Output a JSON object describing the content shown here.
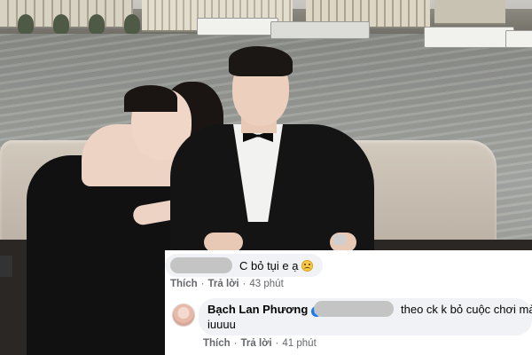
{
  "comments": [
    {
      "author_redacted": true,
      "text": "C bỏ tụi e ạ",
      "emoji": "disappointed-face-emoji",
      "actions": {
        "like": "Thích",
        "reply": "Trả lời",
        "separator": "·",
        "time": "43 phút"
      }
    },
    {
      "author": "Bạch Lan Phương",
      "verified": true,
      "tagged_redacted": true,
      "text_line1": "theo ck k bỏ cuộc chơi mà e",
      "text_line2": "iuuuu",
      "actions": {
        "like": "Thích",
        "reply": "Trả lời",
        "separator": "·",
        "time": "41 phút"
      }
    }
  ],
  "colors": {
    "bubble": "#f0f2f5",
    "text": "#050505",
    "meta": "#65676b",
    "verified": "#1877f2",
    "redaction": "#c4c4c4"
  }
}
